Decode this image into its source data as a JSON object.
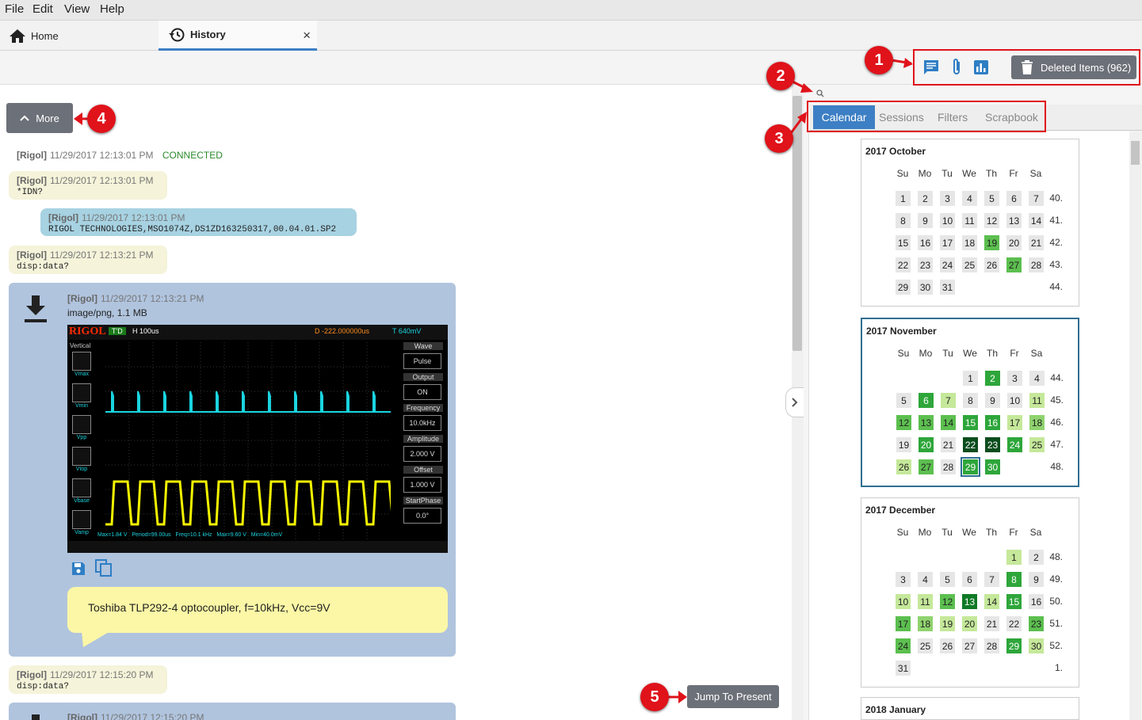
{
  "menu": [
    "File",
    "Edit",
    "View",
    "Help"
  ],
  "tabs": {
    "home": "Home",
    "history": "History",
    "close": "×"
  },
  "toolbar": {
    "deleted_label": "Deleted Items (962)"
  },
  "chat": {
    "more_label": "More",
    "messages": [
      {
        "src": "[Rigol]",
        "ts": "11/29/2017 12:13:01 PM",
        "status": "CONNECTED"
      },
      {
        "src": "[Rigol]",
        "ts": "11/29/2017 12:13:01 PM",
        "body": "*IDN?"
      },
      {
        "src": "[Rigol]",
        "ts": "11/29/2017 12:13:01 PM",
        "body": "RIGOL TECHNOLOGIES,MSO1074Z,DS1ZD163250317,00.04.01.SP2"
      },
      {
        "src": "[Rigol]",
        "ts": "11/29/2017 12:13:21 PM",
        "body": "disp:data?"
      },
      {
        "src": "[Rigol]",
        "ts": "11/29/2017 12:13:21 PM",
        "mime": "image/png, 1.1 MB",
        "note": "Toshiba TLP292-4 optocoupler, f=10kHz, Vcc=9V"
      },
      {
        "src": "[Rigol]",
        "ts": "11/29/2017 12:15:20 PM",
        "body": "disp:data?"
      },
      {
        "src": "[Rigol]",
        "ts": "11/29/2017 12:15:20 PM"
      }
    ],
    "jump_label": "Jump To Present"
  },
  "scope": {
    "brand": "RIGOL",
    "mode": "T'D",
    "timebase": "H 100us",
    "offset": "D -222.000000us",
    "trig": "T 640mV",
    "side": [
      {
        "h": "Wave",
        "v": "Pulse"
      },
      {
        "h": "Output",
        "v": "ON"
      },
      {
        "h": "Frequency",
        "v": "10.0kHz"
      },
      {
        "h": "Amplitude",
        "v": "2.000 V"
      },
      {
        "h": "Offset",
        "v": "1.000 V"
      },
      {
        "h": "StartPhase",
        "v": "0.0°"
      }
    ],
    "left": [
      "Vmax",
      "Vmin",
      "Vpp",
      "Vtop",
      "Vbase",
      "Vamp"
    ],
    "vertical": "Vertical",
    "bottom": "Max=1.84 V   Period=99.00us   Freq=10.1 kHz   Max=9.60 V   Min=40.0mV"
  },
  "panel": {
    "tabs": [
      "Calendar",
      "Sessions",
      "Filters",
      "Scrapbook"
    ],
    "weekdays": [
      "Su",
      "Mo",
      "Tu",
      "We",
      "Th",
      "Fr",
      "Sa"
    ],
    "months": [
      {
        "title": "2017 October",
        "start": 0,
        "days": 31,
        "weeks": [
          "40.",
          "41.",
          "42.",
          "43.",
          "44."
        ],
        "levels": {
          "19": "l3",
          "27": "l3"
        }
      },
      {
        "title": "2017 November",
        "start": 3,
        "days": 30,
        "weeks": [
          "44.",
          "45.",
          "46.",
          "47.",
          "48."
        ],
        "levels": {
          "2": "l4",
          "6": "l4",
          "7": "l1",
          "11": "l1",
          "12": "l3",
          "13": "l3",
          "14": "l3",
          "15": "l4",
          "16": "l4",
          "17": "l1",
          "18": "l2",
          "20": "l4",
          "22": "l6",
          "23": "l6",
          "24": "l4",
          "25": "l1",
          "26": "l1",
          "27": "l3",
          "29": "l4",
          "30": "l4"
        }
      },
      {
        "title": "2017 December",
        "start": 5,
        "days": 31,
        "weeks": [
          "48.",
          "49.",
          "50.",
          "51.",
          "52.",
          "1."
        ],
        "levels": {
          "1": "l1",
          "8": "l4",
          "10": "l1",
          "11": "l1",
          "12": "l3",
          "13": "l5",
          "14": "l1",
          "15": "l4",
          "17": "l3",
          "18": "l2",
          "19": "l1",
          "20": "l1",
          "23": "l3",
          "24": "l3",
          "29": "l4",
          "30": "l1"
        }
      },
      {
        "title": "2018 January"
      }
    ]
  },
  "badges": [
    "1",
    "2",
    "3",
    "4",
    "5"
  ],
  "colors": {
    "accent": "#3d7fc4",
    "annotation": "#e0121a"
  }
}
